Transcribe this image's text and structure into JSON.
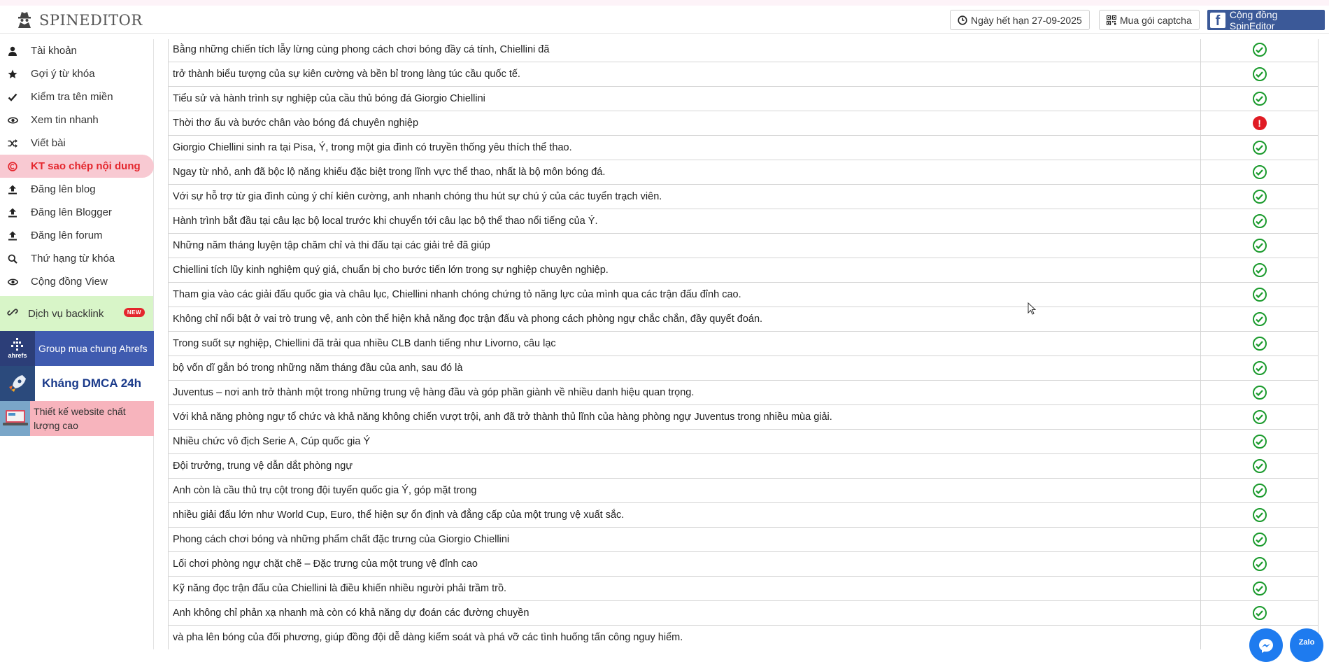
{
  "header": {
    "logo_text": "SPINEDITOR",
    "expiry_label": "Ngày hết hạn 27-09-2025",
    "captcha_label": "Mua gói captcha",
    "community_label": "Cộng đồng SpinEditor",
    "facebook_letter": "f"
  },
  "sidebar": {
    "items": [
      {
        "label": "Tài khoản",
        "icon": "user-icon"
      },
      {
        "label": "Gợi ý từ khóa",
        "icon": "star-icon"
      },
      {
        "label": "Kiểm tra tên miền",
        "icon": "check-icon"
      },
      {
        "label": "Xem tin nhanh",
        "icon": "eye-icon"
      },
      {
        "label": "Viết bài",
        "icon": "shuffle-icon"
      },
      {
        "label": "KT sao chép nội dung",
        "icon": "copyright-icon"
      },
      {
        "label": "Đăng lên blog",
        "icon": "upload-icon"
      },
      {
        "label": "Đăng lên Blogger",
        "icon": "upload-icon"
      },
      {
        "label": "Đăng lên forum",
        "icon": "upload-icon"
      },
      {
        "label": "Thứ hạng từ khóa",
        "icon": "search-icon"
      },
      {
        "label": "Cộng đồng View",
        "icon": "eye-icon"
      }
    ],
    "backlink_label": "Dịch vụ backlink",
    "new_badge": "NEW",
    "promo_ahrefs": "Group mua chung Ahrefs",
    "promo_ahrefs_logo": "ahrefs",
    "promo_dmca": "Kháng DMCA 24h",
    "promo_website": "Thiết kế website chất lượng cao"
  },
  "rows": [
    {
      "text": "Bằng những chiến tích lẫy lừng cùng phong cách chơi bóng đầy cá tính, Chiellini đã",
      "status": "ok"
    },
    {
      "text": "trở thành biểu tượng của sự kiên cường và bền bỉ trong làng túc cầu quốc tế.",
      "status": "ok"
    },
    {
      "text": "Tiểu sử và hành trình sự nghiệp của cầu thủ bóng đá Giorgio Chiellini",
      "status": "ok"
    },
    {
      "text": "Thời thơ ấu và bước chân vào bóng đá chuyên nghiệp",
      "status": "error"
    },
    {
      "text": "Giorgio Chiellini sinh ra tại Pisa, Ý, trong một gia đình có truyền thống yêu thích thể thao.",
      "status": "ok"
    },
    {
      "text": "Ngay từ nhỏ, anh đã bộc lộ năng khiếu đặc biệt trong lĩnh vực thể thao, nhất là bộ môn bóng đá.",
      "status": "ok"
    },
    {
      "text": "Với sự hỗ trợ từ gia đình cùng ý chí kiên cường, anh nhanh chóng thu hút sự chú ý của các tuyển trạch viên.",
      "status": "ok"
    },
    {
      "text": "Hành trình bắt đầu tại câu lạc bộ local trước khi chuyển tới câu lạc bộ thể thao nổi tiếng của Ý.",
      "status": "ok"
    },
    {
      "text": "Những năm tháng luyện tập chăm chỉ và thi đấu tại các giải trẻ đã giúp",
      "status": "ok"
    },
    {
      "text": "Chiellini tích lũy kinh nghiệm quý giá, chuẩn bị cho bước tiến lớn trong sự nghiệp chuyên nghiệp.",
      "status": "ok"
    },
    {
      "text": "Tham gia vào các giải đấu quốc gia và châu lục, Chiellini nhanh chóng chứng tỏ năng lực của mình qua các trận đấu đỉnh cao.",
      "status": "ok"
    },
    {
      "text": "Không chỉ nổi bật ở vai trò trung vệ, anh còn thể hiện khả năng đọc trận đấu và phong cách phòng ngự chắc chắn, đầy quyết đoán.",
      "status": "ok"
    },
    {
      "text": "Trong suốt sự nghiệp, Chiellini đã trải qua nhiều CLB danh tiếng như Livorno, câu lạc",
      "status": "ok"
    },
    {
      "text": "bộ vốn dĩ gắn bó trong những năm tháng đầu của anh, sau đó là",
      "status": "ok"
    },
    {
      "text": "Juventus – nơi anh trở thành một trong những trung vệ hàng đầu và góp phần giành về nhiều danh hiệu quan trọng.",
      "status": "ok"
    },
    {
      "text": "Với khả năng phòng ngự tổ chức và khả năng không chiến vượt trội, anh đã trở thành thủ lĩnh của hàng phòng ngự Juventus trong nhiều mùa giải.",
      "status": "ok"
    },
    {
      "text": "Nhiều chức vô địch Serie A, Cúp quốc gia Ý",
      "status": "ok"
    },
    {
      "text": "Đội trưởng, trung vệ dẫn dắt phòng ngự",
      "status": "ok"
    },
    {
      "text": "Anh còn là cầu thủ trụ cột trong đội tuyển quốc gia Ý, góp mặt trong",
      "status": "ok"
    },
    {
      "text": "nhiều giải đấu lớn như World Cup, Euro, thể hiện sự ổn định và đẳng cấp của một trung vệ xuất sắc.",
      "status": "ok"
    },
    {
      "text": "Phong cách chơi bóng và những phẩm chất đặc trưng của Giorgio Chiellini",
      "status": "ok"
    },
    {
      "text": "Lối chơi phòng ngự chặt chẽ – Đặc trưng của một trung vệ đỉnh cao",
      "status": "ok"
    },
    {
      "text": "Kỹ năng đọc trận đấu của Chiellini là điều khiến nhiều người phải trầm trồ.",
      "status": "ok"
    },
    {
      "text": "Anh không chỉ phản xạ nhanh mà còn có khả năng dự đoán các đường chuyền",
      "status": "ok"
    },
    {
      "text": "và pha lên bóng của đối phương, giúp đồng đội dễ dàng kiểm soát và phá vỡ các tình huống tấn công nguy hiểm.",
      "status": "ok"
    }
  ],
  "status_symbols": {
    "error": "!"
  },
  "chat": {
    "zalo_label": "Zalo"
  },
  "colors": {
    "ok": "#1a9a2c",
    "error": "#e01b24",
    "active_bg": "#f8c9d2",
    "active_text": "#e4262d",
    "facebook": "#3b5998"
  }
}
